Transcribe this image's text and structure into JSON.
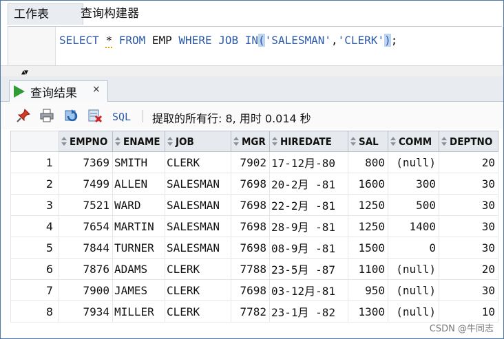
{
  "top_tabs": [
    "工作表",
    "查询构建器"
  ],
  "editor": {
    "sql_parts": {
      "select": "SELECT ",
      "star": "*",
      "from": " FROM ",
      "table": "EMP",
      "where": " WHERE ",
      "col": "JOB",
      "in": " IN",
      "open": "(",
      "v1": "'SALESMAN'",
      "comma": ",",
      "v2": "'CLERK'",
      "close": ")",
      "semi": ";"
    }
  },
  "results_tab": {
    "label": "查询结果",
    "close": "×",
    "icon": "play-icon"
  },
  "toolbar": {
    "icons": [
      "pin-icon",
      "print-icon",
      "refresh-icon",
      "export-icon"
    ],
    "sql_label": "SQL",
    "status": "提取的所有行: 8, 用时 0.014 秒"
  },
  "grid": {
    "columns": [
      "EMPNO",
      "ENAME",
      "JOB",
      "MGR",
      "HIREDATE",
      "SAL",
      "COMM",
      "DEPTNO"
    ],
    "rows": [
      [
        "1",
        "7369",
        "SMITH",
        "CLERK",
        "7902",
        "17-12月-80",
        "800",
        "(null)",
        "20"
      ],
      [
        "2",
        "7499",
        "ALLEN",
        "SALESMAN",
        "7698",
        "20-2月 -81",
        "1600",
        "300",
        "30"
      ],
      [
        "3",
        "7521",
        "WARD",
        "SALESMAN",
        "7698",
        "22-2月 -81",
        "1250",
        "500",
        "30"
      ],
      [
        "4",
        "7654",
        "MARTIN",
        "SALESMAN",
        "7698",
        "28-9月 -81",
        "1250",
        "1400",
        "30"
      ],
      [
        "5",
        "7844",
        "TURNER",
        "SALESMAN",
        "7698",
        "08-9月 -81",
        "1500",
        "0",
        "30"
      ],
      [
        "6",
        "7876",
        "ADAMS",
        "CLERK",
        "7788",
        "23-5月 -87",
        "1100",
        "(null)",
        "20"
      ],
      [
        "7",
        "7900",
        "JAMES",
        "CLERK",
        "7698",
        "03-12月-81",
        "950",
        "(null)",
        "30"
      ],
      [
        "8",
        "7934",
        "MILLER",
        "CLERK",
        "7782",
        "23-1月 -82",
        "1300",
        "(null)",
        "10"
      ]
    ]
  },
  "watermark": "CSDN @牛同志",
  "colors": {
    "keyword": "#2d5aa8",
    "run_green": "#2f9a36",
    "header_bg": "#e6e9ee"
  }
}
